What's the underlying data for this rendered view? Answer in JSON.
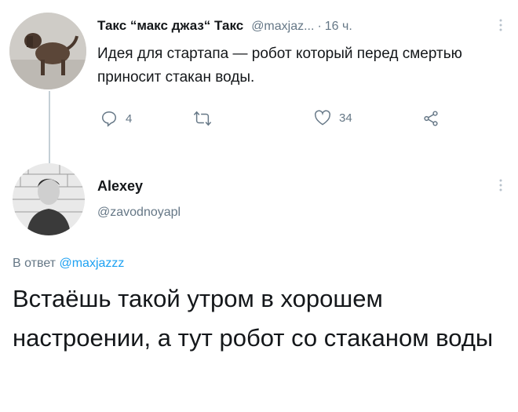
{
  "tweet": {
    "display_name": "Такс “макс джаз“ Такс",
    "handle": "@maxjaz...",
    "separator": "·",
    "time": "16 ч.",
    "text": "Идея для стартапа — робот который перед смертью приносит стакан воды.",
    "actions": {
      "reply_count": "4",
      "retweet_count": "",
      "like_count": "34"
    },
    "icons": [
      "reply-icon",
      "retweet-icon",
      "like-icon",
      "share-icon",
      "more-icon"
    ]
  },
  "reply": {
    "display_name": "Alexey",
    "handle": "@zavodnoyapl",
    "reply_prefix": "В ответ",
    "reply_mention": "@maxjazzz",
    "text": "Встаёшь такой утром в хорошем настроении, а тут робот со стаканом воды"
  },
  "colors": {
    "text": "#14171a",
    "secondary": "#657786",
    "link": "#1da1f2",
    "thread_line": "#c4cfd6"
  }
}
